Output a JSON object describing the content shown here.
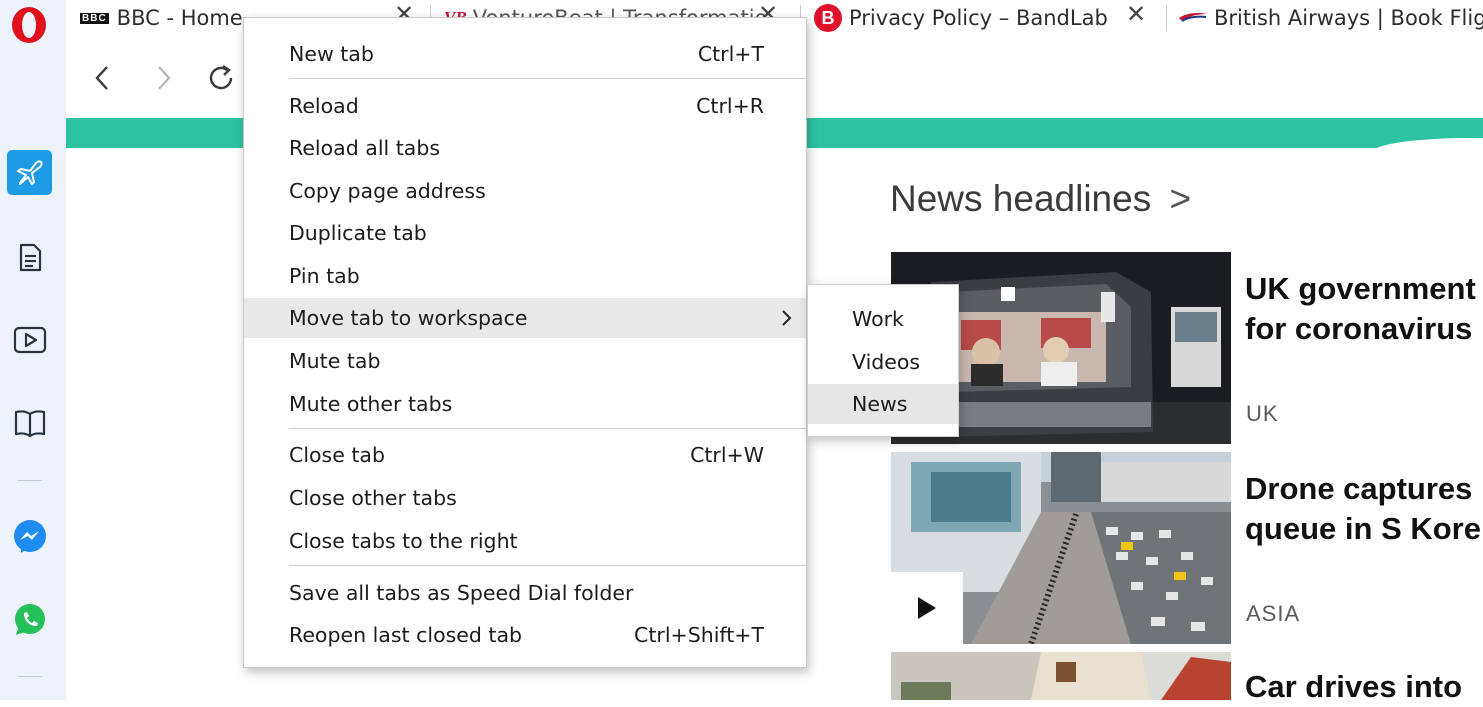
{
  "tabs": [
    {
      "favicon": "BBC",
      "title": "BBC - Home"
    },
    {
      "favicon": "VB",
      "title": "VentureBeat | Transformatio"
    },
    {
      "favicon": "B",
      "title": "Privacy Policy – BandLab UK"
    },
    {
      "favicon": "",
      "title": "British Airways | Book Flight"
    }
  ],
  "context_menu": {
    "items": [
      {
        "label": "New tab",
        "shortcut": "Ctrl+T"
      },
      {
        "label": "Reload",
        "shortcut": "Ctrl+R"
      },
      {
        "label": "Reload all tabs",
        "shortcut": ""
      },
      {
        "label": "Copy page address",
        "shortcut": ""
      },
      {
        "label": "Duplicate tab",
        "shortcut": ""
      },
      {
        "label": "Pin tab",
        "shortcut": ""
      },
      {
        "label": "Move tab to workspace",
        "shortcut": ""
      },
      {
        "label": "Mute tab",
        "shortcut": ""
      },
      {
        "label": "Mute other tabs",
        "shortcut": ""
      },
      {
        "label": "Close tab",
        "shortcut": "Ctrl+W"
      },
      {
        "label": "Close other tabs",
        "shortcut": ""
      },
      {
        "label": "Close tabs to the right",
        "shortcut": ""
      },
      {
        "label": "Save all tabs as Speed Dial folder",
        "shortcut": ""
      },
      {
        "label": "Reopen last closed tab",
        "shortcut": "Ctrl+Shift+T"
      }
    ],
    "highlighted_item": "Move tab to workspace"
  },
  "workspace_submenu": {
    "items": [
      "Work",
      "Videos",
      "News"
    ],
    "highlighted_item": "News"
  },
  "page": {
    "section_title": "News headlines",
    "section_arrow": ">",
    "stories": [
      {
        "title_lines": [
          "UK government",
          "for coronavirus"
        ],
        "tag": "UK"
      },
      {
        "title_lines": [
          "Drone captures",
          "queue in S Kore"
        ],
        "tag": "ASIA"
      },
      {
        "title_lines": [
          "Car drives into"
        ],
        "tag": ""
      }
    ]
  },
  "colors": {
    "sidebar_bg": "#eef3fb",
    "sidebar_active": "#1e9be6",
    "teal_band": "#2ec3a0",
    "menu_highlight": "#e9e9e9",
    "opera_red": "#e0111c"
  }
}
